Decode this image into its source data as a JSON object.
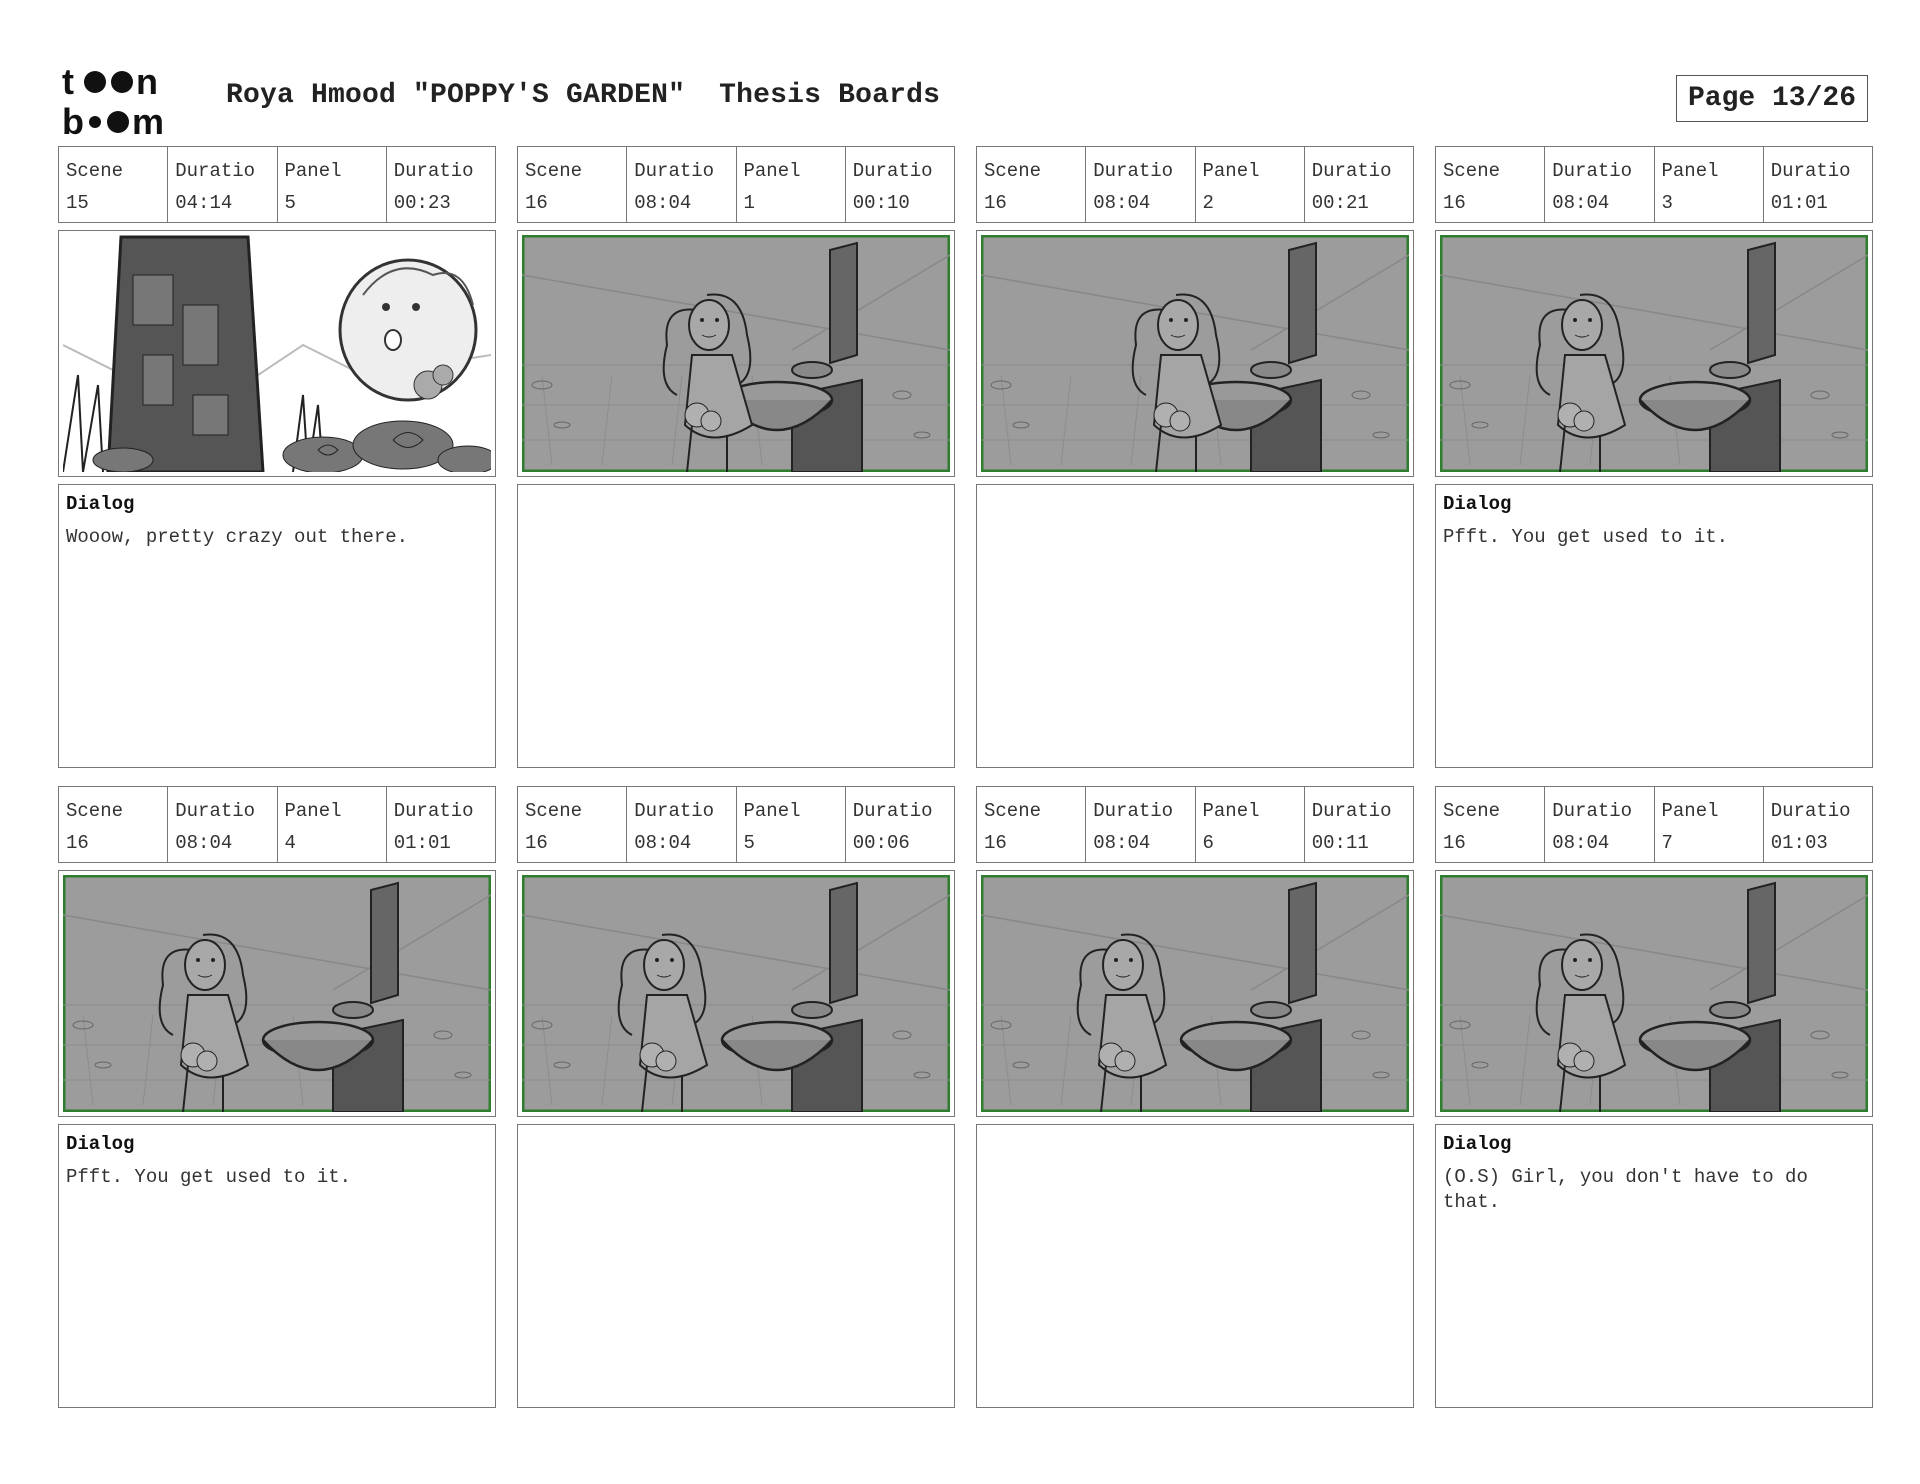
{
  "header": {
    "logo": "toon boom",
    "title": "Roya Hmood \"POPPY'S GARDEN\"  Thesis Boards",
    "page": "Page 13/26"
  },
  "colors": {
    "border": "#777777",
    "frame_green": "#2f7d2f",
    "sketch_bg": "#9a9a9a"
  },
  "panels": [
    {
      "scene_label": "Scene",
      "scene": "15",
      "scene_duration_label": "Duratio",
      "scene_duration": "04:14",
      "panel_label": "Panel",
      "panel": "5",
      "panel_duration_label": "Duratio",
      "panel_duration": "00:23",
      "dialog_label": "Dialog",
      "dialog": "Wooow, pretty crazy out there."
    },
    {
      "scene_label": "Scene",
      "scene": "16",
      "scene_duration_label": "Duratio",
      "scene_duration": "08:04",
      "panel_label": "Panel",
      "panel": "1",
      "panel_duration_label": "Duratio",
      "panel_duration": "00:10",
      "dialog_label": "",
      "dialog": ""
    },
    {
      "scene_label": "Scene",
      "scene": "16",
      "scene_duration_label": "Duratio",
      "scene_duration": "08:04",
      "panel_label": "Panel",
      "panel": "2",
      "panel_duration_label": "Duratio",
      "panel_duration": "00:21",
      "dialog_label": "",
      "dialog": ""
    },
    {
      "scene_label": "Scene",
      "scene": "16",
      "scene_duration_label": "Duratio",
      "scene_duration": "08:04",
      "panel_label": "Panel",
      "panel": "3",
      "panel_duration_label": "Duratio",
      "panel_duration": "01:01",
      "dialog_label": "Dialog",
      "dialog": "Pfft. You get used to it."
    },
    {
      "scene_label": "Scene",
      "scene": "16",
      "scene_duration_label": "Duratio",
      "scene_duration": "08:04",
      "panel_label": "Panel",
      "panel": "4",
      "panel_duration_label": "Duratio",
      "panel_duration": "01:01",
      "dialog_label": "Dialog",
      "dialog": "Pfft. You get used to it."
    },
    {
      "scene_label": "Scene",
      "scene": "16",
      "scene_duration_label": "Duratio",
      "scene_duration": "08:04",
      "panel_label": "Panel",
      "panel": "5",
      "panel_duration_label": "Duratio",
      "panel_duration": "00:06",
      "dialog_label": "",
      "dialog": ""
    },
    {
      "scene_label": "Scene",
      "scene": "16",
      "scene_duration_label": "Duratio",
      "scene_duration": "08:04",
      "panel_label": "Panel",
      "panel": "6",
      "panel_duration_label": "Duratio",
      "panel_duration": "00:11",
      "dialog_label": "",
      "dialog": ""
    },
    {
      "scene_label": "Scene",
      "scene": "16",
      "scene_duration_label": "Duratio",
      "scene_duration": "08:04",
      "panel_label": "Panel",
      "panel": "7",
      "panel_duration_label": "Duratio",
      "panel_duration": "01:03",
      "dialog_label": "Dialog",
      "dialog": "(O.S) Girl, you don't have to do that."
    }
  ]
}
